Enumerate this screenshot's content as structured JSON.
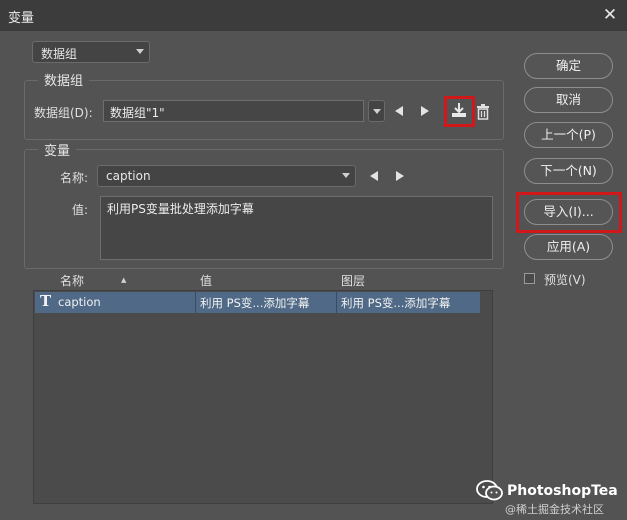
{
  "window": {
    "title": "变量",
    "close_glyph": "✕"
  },
  "top_select": {
    "value": "数据组"
  },
  "data_group": {
    "legend": "数据组",
    "label": "数据组(D):",
    "value": "数据组\"1\""
  },
  "variable": {
    "legend": "变量",
    "name_label": "名称:",
    "name_value": "caption",
    "value_label": "值:",
    "value_text": "利用PS变量批处理添加字幕"
  },
  "table": {
    "columns": [
      "名称",
      "值",
      "图层"
    ],
    "sort_glyph": "▲",
    "rows": [
      {
        "icon": "T",
        "name": "caption",
        "value": "利用 PS变...添加字幕",
        "layer": "利用 PS变...添加字幕"
      }
    ]
  },
  "buttons": {
    "ok": "确定",
    "cancel": "取消",
    "prev": "上一个(P)",
    "next": "下一个(N)",
    "import": "导入(I)...",
    "apply": "应用(A)"
  },
  "preview": {
    "label": "预览(V)",
    "checked": false
  },
  "watermark": {
    "brand": "PhotoshopTea",
    "community": "@稀土掘金技术社区"
  },
  "colors": {
    "highlight": "#d0181a",
    "selected_row": "#4f6986",
    "background": "#535353"
  }
}
